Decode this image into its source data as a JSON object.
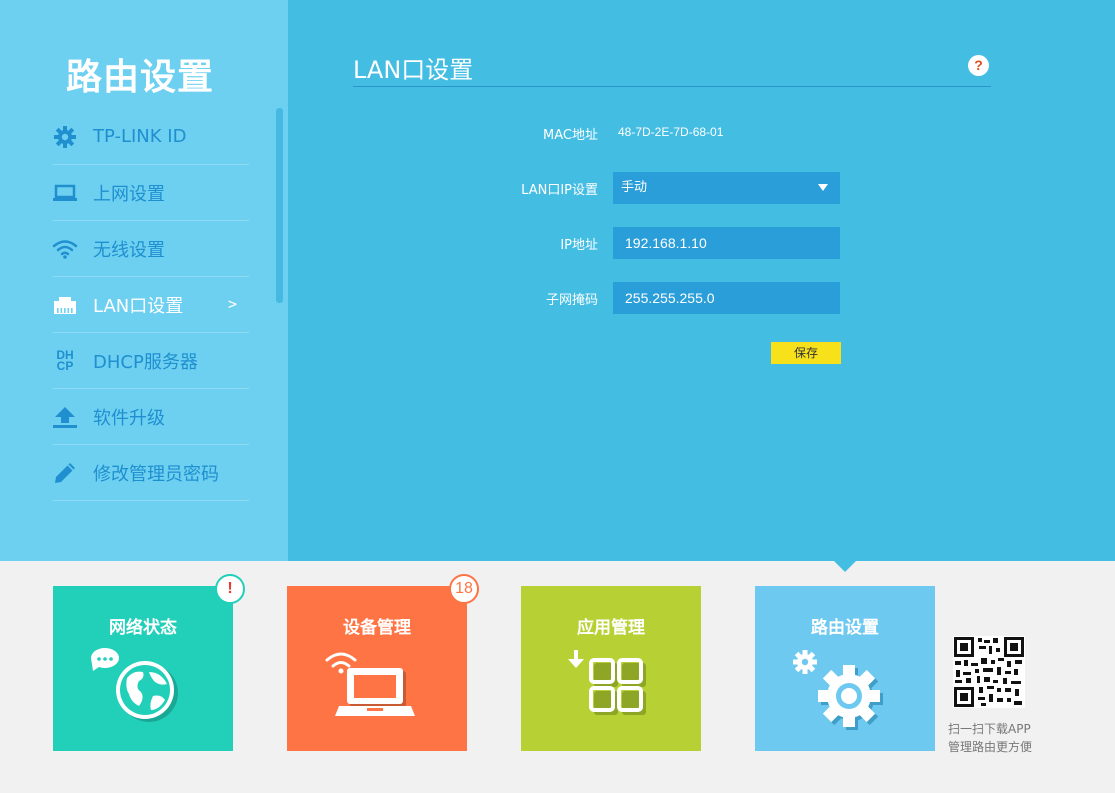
{
  "sidebar": {
    "title": "路由设置",
    "items": [
      {
        "label": "TP-LINK ID",
        "icon": "gear-icon"
      },
      {
        "label": "上网设置",
        "icon": "laptop-icon"
      },
      {
        "label": "无线设置",
        "icon": "wifi-icon"
      },
      {
        "label": "LAN口设置",
        "icon": "ethernet-icon",
        "active": true
      },
      {
        "label": "DHCP服务器",
        "icon": "dhcp-icon",
        "icon_text": "DH\nCP"
      },
      {
        "label": "软件升级",
        "icon": "upload-icon"
      },
      {
        "label": "修改管理员密码",
        "icon": "pencil-icon"
      }
    ],
    "active_arrow": ">"
  },
  "panel": {
    "title": "LAN口设置",
    "help": "?",
    "mac_label": "MAC地址",
    "mac_value": "48-7D-2E-7D-68-01",
    "lan_ip_mode_label": "LAN口IP设置",
    "lan_ip_mode_value": "手动",
    "ip_label": "IP地址",
    "ip_value": "192.168.1.10",
    "mask_label": "子网掩码",
    "mask_value": "255.255.255.0",
    "save_label": "保存"
  },
  "tiles": [
    {
      "label": "网络状态",
      "color": "#22cfb8",
      "badge": "!"
    },
    {
      "label": "设备管理",
      "color": "#fe7445",
      "badge": "18"
    },
    {
      "label": "应用管理",
      "color": "#b7d135"
    },
    {
      "label": "路由设置",
      "color": "#6dc9ef",
      "active": true
    }
  ],
  "qr": {
    "line1": "扫一扫下载APP",
    "line2": "管理路由更方便"
  },
  "colors": {
    "sidebar_bg": "#6dd0f1",
    "main_bg": "#44bde3",
    "field_bg": "#2a9ed9",
    "save_btn": "#f6e11b"
  }
}
